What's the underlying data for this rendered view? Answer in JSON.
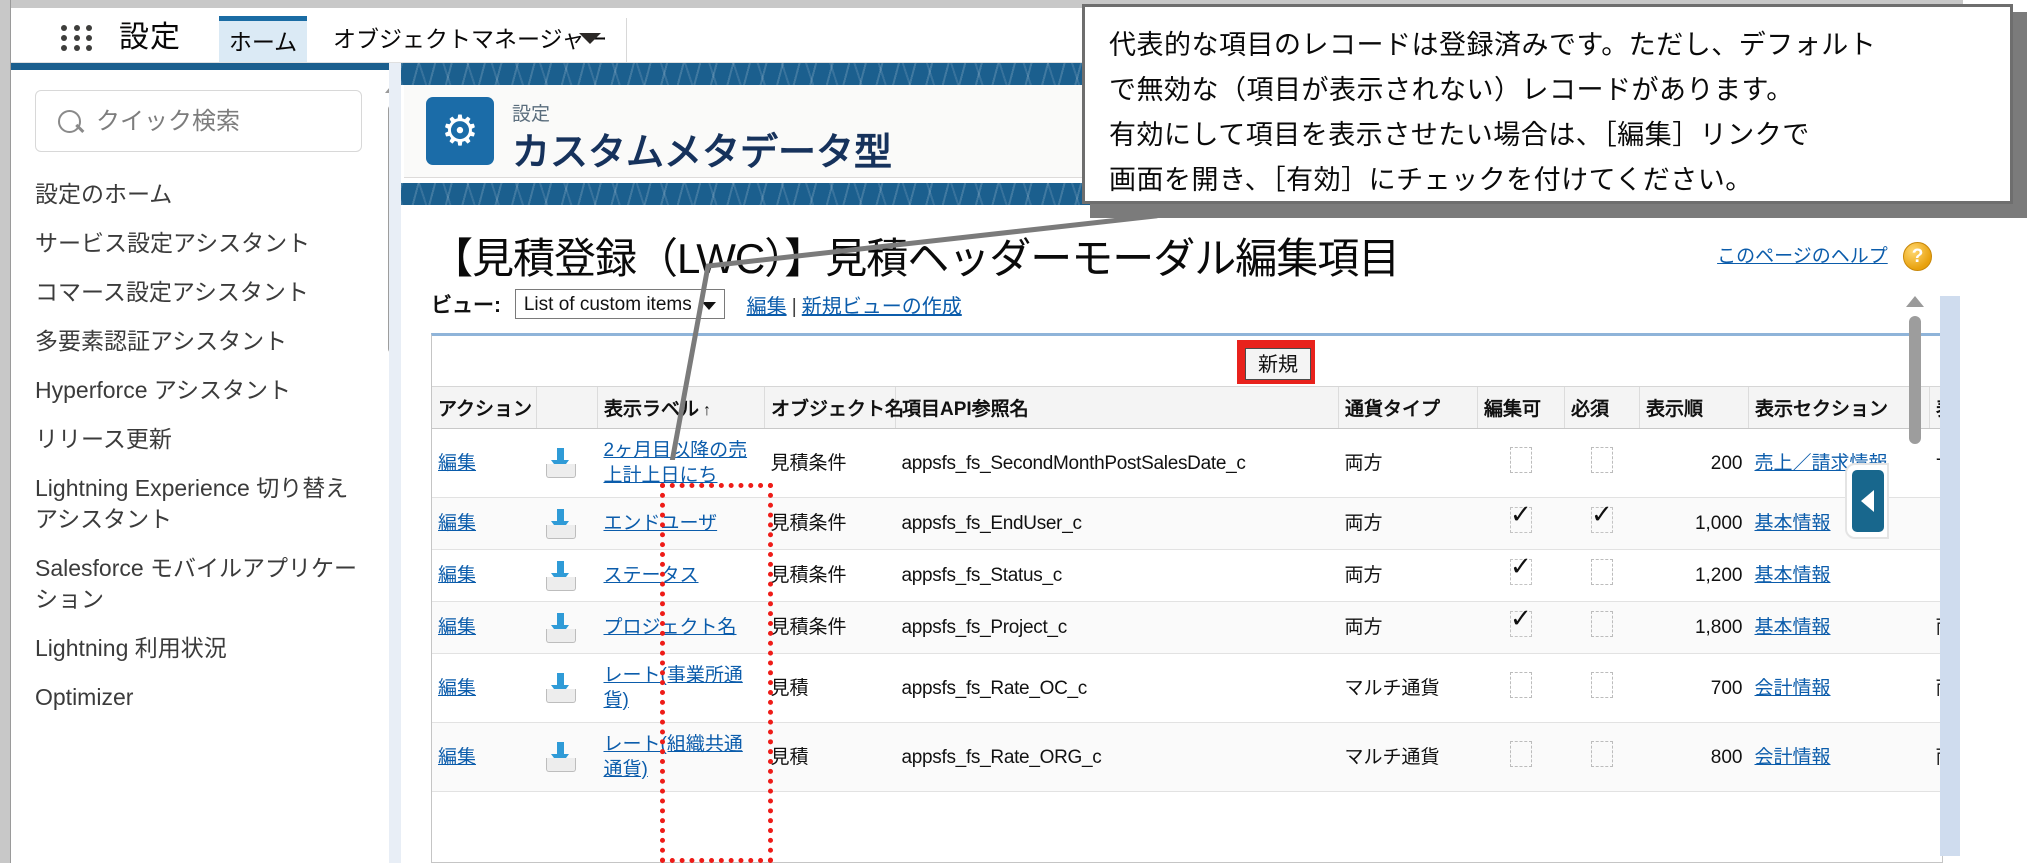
{
  "header": {
    "app_launcher_icon": "waffle-grid-icon",
    "setup_word": "設定",
    "tabs": [
      {
        "label": "ホーム",
        "active": true
      },
      {
        "label": "オブジェクトマネージャー",
        "active": false
      }
    ],
    "objmgr_caret_icon": "chevron-down-icon"
  },
  "sidebar": {
    "search": {
      "icon": "search-icon",
      "value": "",
      "placeholder": "クイック検索"
    },
    "items": [
      {
        "label": "設定のホーム"
      },
      {
        "label": "サービス設定アシスタント"
      },
      {
        "label": "コマース設定アシスタント"
      },
      {
        "label": "多要素認証アシスタント"
      },
      {
        "label": "Hyperforce アシスタント"
      },
      {
        "label": "リリース更新"
      },
      {
        "label": "Lightning Experience 切り替えアシスタント"
      },
      {
        "label": "Salesforce モバイルアプリケーション"
      },
      {
        "label": "Lightning 利用状況"
      },
      {
        "label": "Optimizer"
      }
    ],
    "scroll_up_icon": "triangle-up-icon"
  },
  "setup_card": {
    "gear_icon": "gear-icon",
    "kicker": "設定",
    "title": "カスタムメタデータ型"
  },
  "content": {
    "page_title": "【見積登録（LWC）】見積ヘッダーモーダル編集項目",
    "help_link": "このページのヘルプ",
    "help_icon": "question-mark-icon",
    "view": {
      "label": "ビュー:",
      "selected": "List of custom items",
      "caret_icon": "chevron-down-icon",
      "edit_link": "編集",
      "separator": "|",
      "create_link": "新規ビューの作成"
    },
    "toolbar": {
      "new_button": "新規",
      "highlight_color": "#e8221c"
    },
    "table": {
      "columns": [
        "アクション",
        "",
        "表示ラベル",
        "オブジェクト名",
        "項目API参照名",
        "通貨タイプ",
        "編集可",
        "必須",
        "表示順",
        "表示セクション",
        "表"
      ],
      "sort_column": "表示ラベル",
      "sort_icon": "arrow-up-icon",
      "row_icon": "download-to-tray-icon",
      "rows": [
        {
          "action": "編集",
          "label": "2ヶ月目以降の売上計上日にち",
          "object": "見積条件",
          "api": "appsfs_fs_SecondMonthPostSalesDate_c",
          "currency_type": "両方",
          "editable": false,
          "required": false,
          "order": "200",
          "section": "売上／請求情報",
          "last": "サ"
        },
        {
          "action": "編集",
          "label": "エンドユーザ",
          "object": "見積条件",
          "api": "appsfs_fs_EndUser_c",
          "currency_type": "両方",
          "editable": true,
          "required": true,
          "order": "1,000",
          "section": "基本情報",
          "last": ""
        },
        {
          "action": "編集",
          "label": "ステータス",
          "object": "見積条件",
          "api": "appsfs_fs_Status_c",
          "currency_type": "両方",
          "editable": true,
          "required": false,
          "order": "1,200",
          "section": "基本情報",
          "last": ""
        },
        {
          "action": "編集",
          "label": "プロジェクト名",
          "object": "見積条件",
          "api": "appsfs_fs_Project_c",
          "currency_type": "両方",
          "editable": true,
          "required": false,
          "order": "1,800",
          "section": "基本情報",
          "last": "両"
        },
        {
          "action": "編集",
          "label": "レート(事業所通貨)",
          "object": "見積",
          "api": "appsfs_fs_Rate_OC_c",
          "currency_type": "マルチ通貨",
          "editable": false,
          "required": false,
          "order": "700",
          "section": "会計情報",
          "last": "両"
        },
        {
          "action": "編集",
          "label": "レート(組織共通通貨)",
          "object": "見積",
          "api": "appsfs_fs_Rate_ORG_c",
          "currency_type": "マルチ通貨",
          "editable": false,
          "required": false,
          "order": "800",
          "section": "会計情報",
          "last": "両"
        }
      ]
    },
    "collapse_handle_icon": "triangle-left-icon"
  },
  "callout": {
    "lines": [
      "代表的な項目のレコードは登録済みです。ただし、デフォルト",
      "で無効な（項目が表示されない）レコードがあります。",
      "有効にして項目を表示させたい場合は、［編集］リンクで",
      "画面を開き、［有効］にチェックを付けてください。"
    ]
  }
}
